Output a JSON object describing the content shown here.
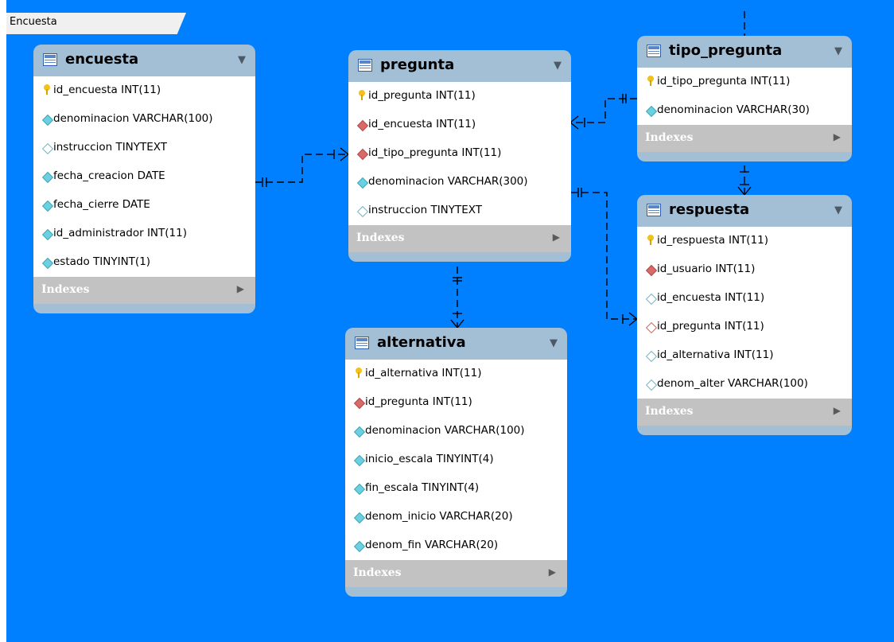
{
  "layer": {
    "name": "Encuesta"
  },
  "indexes_label": "Indexes",
  "icons": {
    "table": "table-icon",
    "collapse": "triangle-down-icon",
    "expand": "triangle-right-icon",
    "pk": "key-icon",
    "fk": "red-diamond-icon",
    "nn": "cyan-diamond-icon",
    "nullable": "white-diamond-icon"
  },
  "tables": {
    "encuesta": {
      "name": "encuesta",
      "columns": [
        {
          "label": "id_encuesta INT(11)",
          "kind": "pk"
        },
        {
          "label": "denominacion VARCHAR(100)",
          "kind": "nn"
        },
        {
          "label": "instruccion TINYTEXT",
          "kind": "null"
        },
        {
          "label": "fecha_creacion DATE",
          "kind": "nn"
        },
        {
          "label": "fecha_cierre DATE",
          "kind": "nn"
        },
        {
          "label": "id_administrador INT(11)",
          "kind": "nn"
        },
        {
          "label": "estado TINYINT(1)",
          "kind": "nn"
        }
      ]
    },
    "pregunta": {
      "name": "pregunta",
      "columns": [
        {
          "label": "id_pregunta INT(11)",
          "kind": "pk"
        },
        {
          "label": "id_encuesta INT(11)",
          "kind": "fk"
        },
        {
          "label": "id_tipo_pregunta INT(11)",
          "kind": "fk"
        },
        {
          "label": "denominacion VARCHAR(300)",
          "kind": "nn"
        },
        {
          "label": "instruccion TINYTEXT",
          "kind": "null"
        }
      ]
    },
    "tipo_pregunta": {
      "name": "tipo_pregunta",
      "columns": [
        {
          "label": "id_tipo_pregunta INT(11)",
          "kind": "pk"
        },
        {
          "label": "denominacion VARCHAR(30)",
          "kind": "nn"
        }
      ]
    },
    "respuesta": {
      "name": "respuesta",
      "columns": [
        {
          "label": "id_respuesta INT(11)",
          "kind": "pk"
        },
        {
          "label": "id_usuario INT(11)",
          "kind": "fk"
        },
        {
          "label": "id_encuesta INT(11)",
          "kind": "null"
        },
        {
          "label": "id_pregunta INT(11)",
          "kind": "fknull"
        },
        {
          "label": "id_alternativa INT(11)",
          "kind": "null"
        },
        {
          "label": "denom_alter VARCHAR(100)",
          "kind": "null"
        }
      ]
    },
    "alternativa": {
      "name": "alternativa",
      "columns": [
        {
          "label": "id_alternativa INT(11)",
          "kind": "pk"
        },
        {
          "label": "id_pregunta INT(11)",
          "kind": "fk"
        },
        {
          "label": "denominacion VARCHAR(100)",
          "kind": "nn"
        },
        {
          "label": "inicio_escala TINYINT(4)",
          "kind": "nn"
        },
        {
          "label": "fin_escala TINYINT(4)",
          "kind": "nn"
        },
        {
          "label": "denom_inicio VARCHAR(20)",
          "kind": "nn"
        },
        {
          "label": "denom_fin VARCHAR(20)",
          "kind": "nn"
        }
      ]
    }
  },
  "relationships": [
    {
      "from": "encuesta",
      "to": "pregunta",
      "type": "one-to-many",
      "style": "dashed"
    },
    {
      "from": "tipo_pregunta",
      "to": "pregunta",
      "type": "one-to-many",
      "style": "dashed"
    },
    {
      "from": "pregunta",
      "to": "alternativa",
      "type": "one-to-many",
      "style": "dashed"
    },
    {
      "from": "pregunta",
      "to": "respuesta",
      "type": "one-to-many",
      "style": "dashed"
    },
    {
      "from": "tipo_pregunta",
      "to": "respuesta",
      "type": "one-to-many",
      "style": "dashed"
    }
  ]
}
